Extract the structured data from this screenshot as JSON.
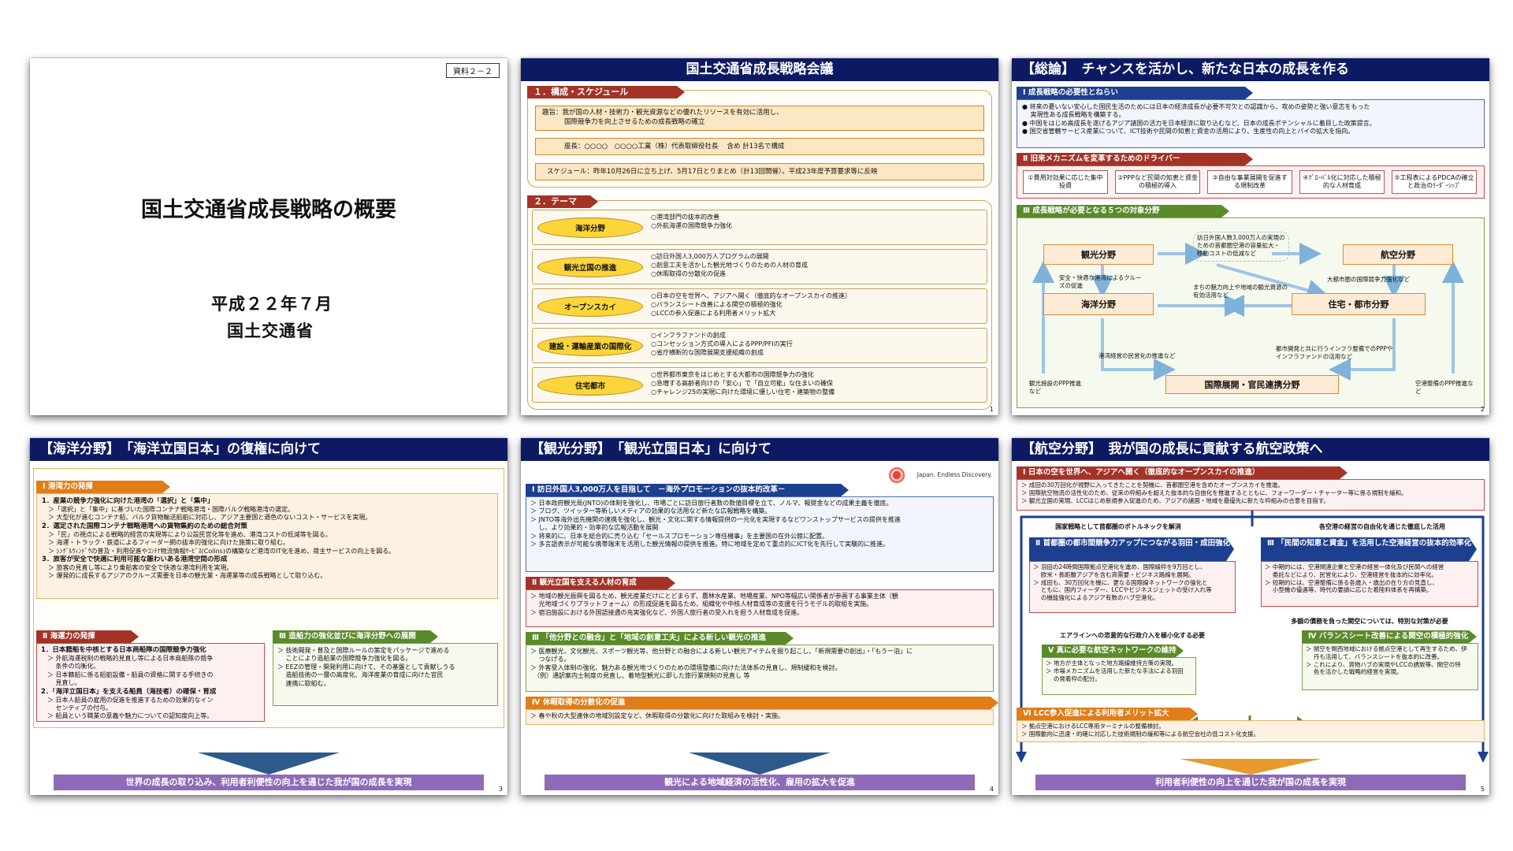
{
  "slide1": {
    "tag": "資料２－２",
    "title": "国土交通省成長戦略の概要",
    "date": "平成２２年７月",
    "org": "国土交通省"
  },
  "slide2": {
    "title": "国土交通省成長戦略会議",
    "sec1": "１．構成・スケジュール",
    "purpose1": "趣旨：我が国の人材・技術力・観光資源などの優れたリソースを有効に活用し、",
    "purpose2": "国際競争力を向上させるための成長戦略の確立",
    "chair": "座長：○○○○　○○○○工業（株）代表取締役社長　 含め 計13名で構成",
    "schedule": "スケジュール：昨年10月26日に立ち上げ、5月17日とりまとめ（計13回開催）。平成23年度予算要求等に反映",
    "sec2": "２．テーマ",
    "themes": [
      {
        "name": "海洋分野",
        "items": [
          "○港湾部門の抜本的改善",
          "○外航海運の国際競争力強化"
        ]
      },
      {
        "name": "観光立国の推進",
        "items": [
          "○訪日外国人3,000万人プログラムの展開",
          "○創意工夫を活かした観光地づくりのための人材の育成",
          "○休暇取得の分散化の促進"
        ]
      },
      {
        "name": "オープンスカイ",
        "items": [
          "○日本の空を世界へ、アジアへ開く（徹底的なオープンスカイの推進）",
          "○バランスシート改善による関空の積極的強化",
          "○LCCの参入促進による利用者メリット拡大"
        ]
      },
      {
        "name": "建設・運輸産業の国際化",
        "items": [
          "○インフラファンドの創成",
          "○コンセッション方式の導入によるPPP/PFIの実行",
          "○省庁横断的な国際展開支援組織の創成"
        ]
      },
      {
        "name": "住宅都市",
        "items": [
          "○世界都市東京をはじめとする大都市の国際競争力の強化",
          "○急増する高齢者向けの「安心」で「自立可能」な住まいの確保",
          "○チャレンジ25の実現に向けた環境に優しい住宅・建築物の整備"
        ]
      }
    ],
    "page": "1"
  },
  "slide3": {
    "title": "【総論】　チャンスを活かし、新たな日本の成長を作る",
    "h1": "Ⅰ 成長戦略の必要性とねらい",
    "b1": [
      "● 将来の憂いない安心した国民生活のためには日本の経済成長が必要不可欠との認識から、攻めの姿勢と強い意志をもった",
      "　 実現性ある成長戦略を構築する。",
      "● 中国をはじめ高成長を遂げるアジア諸国の活力を日本経済に取り込むなど、日本の成長ポテンシャルに着目した政策提言。",
      "● 国交省管轄サービス産業について、ICT技術や民間の知恵と資金の活用により、生産性の向上とパイの拡大を指向。"
    ],
    "h2": "Ⅱ 旧来メカニズムを変革するためのドライバー",
    "drivers": [
      "①費用対効果に応じた集中投資",
      "②PPPなど民間の知恵と資金の積極的導入",
      "③自由な事業展開を促進する規制改革",
      "④ｸﾞﾛｰﾊﾞﾙ化に対応した積極的な人材育成",
      "⑤工程表によるPDCAの確立と政治のﾘｰﾀﾞｰｼｯﾌﾟ"
    ],
    "h3": "Ⅲ 成長戦略が必要となる５つの対象分野",
    "fields": [
      "観光分野",
      "航空分野",
      "海洋分野",
      "住宅・都市分野",
      "国際展開・官民連携分野"
    ],
    "notes": [
      "訪日外国人数3,000万人の実現のための首都圏空港の容量拡大・移動コストの低減など",
      "安全・快適な港湾によるクルーズの促進",
      "まちの魅力向上や地域の観光資源の有効活用など",
      "大都市圏の国際競争力強化など",
      "港湾経営の民営化の推進など",
      "都市開発と共に行うインフラ整備でのPPPやインフラファンドの活用など",
      "観光施設のPPP推進など",
      "空港整備のPPP推進など"
    ],
    "page": "2"
  },
  "slide4": {
    "title": "【海洋分野】　「海洋立国日本」の復権に向けて",
    "h1": "Ⅰ 港湾力の発揮",
    "b1": [
      "1．産業の競争力強化に向けた港湾の「選択」と「集中」",
      "　＞「選択」と「集中」に基づいた国際コンテナ戦略港湾・国際バルク戦略港湾の選定。",
      "　＞ 大型化が進むコンテナ船、バルク貨物輸送船舶に対応し、アジア主要国と遜色のないコスト・サービスを実現。",
      "2．選定された国際コンテナ戦略港湾への貨物集約のための総合対策",
      "　＞「民」の視点による戦略的経営の実現等により公設民営化等を進め、港湾コストの低減等を図る。",
      "　＞ 海運・トラック・鉄道によるフィーダー網の抜本的強化に向けた施策に取り組む。",
      "　＞ ｼﾝｸﾞﾙｳｨﾝﾄﾞｳの普及・利用促進やｺﾝﾃﾅ物流情報ｻｰﾋﾞｽ(Colins)の構築など港湾のIT化を進め、荷主サービスの向上を図る。",
      "3．旅客が安全で快適に利用可能な賑わいある港湾空間の形成",
      "　＞ 旅客の見直し等により乗船客の安全で快適な港湾利用を実現。",
      "　＞ 爆発的に成長するアジアのクルーズ需要を日本の観光業・海運業等の成長戦略として取り込む。"
    ],
    "h2": "Ⅱ 海運力の発揮",
    "b2": [
      "1．日本籍船を中核とする日本商船隊の国際競争力強化",
      "　＞ 外航海運税制の戦略的見直し等による日本商船隊の競争",
      "　　 条件の均衡化。",
      "　＞ 日本籍船に係る船舶設備・船員の資格に関する手続きの",
      "　　 見直し。",
      "2．「海洋立国日本」を支える船員（海技者）の確保・育成",
      "　＞ 日本人船員の雇用の促進を推進するための効果的なイン",
      "　　 センティブの付与。",
      "　＞ 船員という職業の意義や魅力についての認知度向上等。"
    ],
    "h3": "Ⅲ 造船力の強化並びに海洋分野への展開",
    "b3": [
      "＞ 技術開発・普及と国際ルールの策定をパッケージで進める",
      "　 ことにより造船業の国際競争力強化を図る。",
      "＞ EEZの管理・開発利用に向けて、その基盤として貢献しうる",
      "　 造船技術の一層の高度化、海洋産業の育成に向けた官民",
      "　 連携に取組む。"
    ],
    "bottom": "世界の成長の取り込み、利用者利便性の向上を通じた我が国の成長を実現",
    "page": "3"
  },
  "slide5": {
    "title": "【観光分野】　「観光立国日本」に向けて",
    "logo": "Japan. Endless Discovery.",
    "h1": "Ⅰ 訪日外国人3,000万人を目指して　－海外プロモーションの抜本的改革－",
    "b1": [
      "＞ 日本政府観光局(JNTO)の体制を強化し、市場ごとに訪日旅行者数の数値目標を立て、ノルマ、報奨金などの成果主義を徹底。",
      "＞ ブログ、ツイッター等新しいメディアの効果的な活用など新たな広報戦略を構築。",
      "＞ JNTO等海外出先機関の連携を強化し、観光・文化に関する情報提供の一元化を実現するなどワンストップサービスの提供を推進",
      "　 し、より効果的・効率的な広報活動を展開",
      "＞ 将来的に、日本を総合的に売り込む「セールスプロモーション専任機事」を主要国の在外公館に配置。",
      "＞ 多言語表示が可能な携帯端末を活用した観光情報の提供を推進。特に地域を定めて重点的にICT化を先行して実験的に推進。"
    ],
    "h2": "Ⅱ 観光立国を支える人材の育成",
    "b2": [
      "＞ 地域の観光振興を図るため、観光産業だけにとどまらず、農林水産業、地場産業、NPO等幅広い関係者が参画する事業主体（観",
      "　 光地域づくりプラットフォーム）の形成促進を図るため、組織化や中核人材育成等の支援を行うモデル的取組を実施。",
      "＞ 宿泊施設における外国語接遇の充実強化など、外国人旅行者の受入れを担う人材育成を促進。"
    ],
    "h3": "Ⅲ 「他分野との融合」と「地域の創意工夫」による新しい観光の推進",
    "b3": [
      "＞ 医療観光、文化観光、スポーツ観光等、他分野との融合による新しい観光アイテムを掘り起こし、「新規需要の創出」・「もう一泊」に",
      "　 つなげる。",
      "＞ 外客受入体制の強化、魅力ある観光地づくりのための環境整備に向けた法体系の見直し、規制緩和を検討。",
      "　（例）通訳案内士制度の見直し、着地型観光に即した旅行業規制の見直し 等"
    ],
    "h4": "Ⅳ 休暇取得の分散化の促進",
    "b4": [
      "＞ 春や秋の大型連休の地域別設定など、休暇取得の分散化に向けた取組みを検討・実施。"
    ],
    "bottom": "観光による地域経済の活性化、雇用の拡大を促進",
    "page": "4"
  },
  "slide6": {
    "title": "【航空分野】　我が国の成長に貢献する航空政策へ",
    "h1": "Ⅰ 日本の空を世界へ、アジアへ開く（徹底的なオープンスカイの推進）",
    "b1": [
      "＞ 成田の30万回化が視野に入ってきたことを契機に、首都圏空港を含めたオープンスカイを推進。",
      "＞ 国際航空物流の活性化のため、従来の枠組みを超えた抜本的な自由化を推進するとともに、フォーワーダー・チャーター等に係る規制を緩和。",
      "＞ 観光立国の実現、LCCはじめ新規参入促進のため、アジアの諸国・地域を最優先に新たな枠組みの合意を目指す。"
    ],
    "l1": "国家戦略として首都圏のボトルネックを解消",
    "l2": "各空港の経営の自由化を通じた徹底した活用",
    "h2": "Ⅱ 首都圏の都市間競争力アップにつながる羽田・成田強化",
    "b2": [
      "＞ 羽田の24時間国際拠点空港化を進め、国際線枠を9万回とし、",
      "　 欧米・長距離アジアを含む高需要・ビジネス路線を展開。",
      "＞ 成田も、30万回化を機に、更なる国際線ネットワークの強化と",
      "　 ともに、国内フィーダー、LCCやビジネスジェットの受け入れ等",
      "　 の機能強化によるアジア有数のハブ空港化。"
    ],
    "h3": "Ⅲ 「民間の知恵と資金」を活用した空港経営の抜本的効率化",
    "b3": [
      "＞ 中期的には、空港関連企業と空港の経営一体化及び民間への経営",
      "　 委託などにより、民営化により、空港経営を抜本的に効率化。",
      "＞ 短期的には、空港整備に係る各歳入・歳出の在り方の見直し、",
      "　 小型機の優遇等、時代の要請に応じた着陸料体系を再構築。"
    ],
    "l3": "多額の債務を負った関空については、特別な対策が必要",
    "l4": "エアラインへの恣意的な行政介入を極小化する必要",
    "h4": "Ⅴ 真に必要な航空ネットワークの維持",
    "b4": [
      "＞ 地方が主体となった地方路線維持方策の実現。",
      "＞ 市場メカニズムを活用した新たな手法による羽田",
      "　 の発着枠の配分。"
    ],
    "h5": "Ⅳ バランスシート改善による関空の積極的強化",
    "b5": [
      "＞ 関空を関西地域における拠点空港として再生するため、伊",
      "　 丹も活用して、バランスシートを抜本的に改善。",
      "＞ これにより、貨物ハブの実現やLCCの誘致等、関空の特",
      "　 色を活かした戦略的経営を実現。"
    ],
    "h6": "Ⅵ LCC参入促進による利用者メリット拡大",
    "b6": [
      "＞ 拠点空港におけるLCC専用ターミナルの整備検討。",
      "＞ 国際動向に迅速・的確に対応した技術規制の緩和等による航空会社の低コスト化支援。"
    ],
    "bottom": "利用者利便性の向上を通じた我が国の成長を実現",
    "page": "5"
  }
}
